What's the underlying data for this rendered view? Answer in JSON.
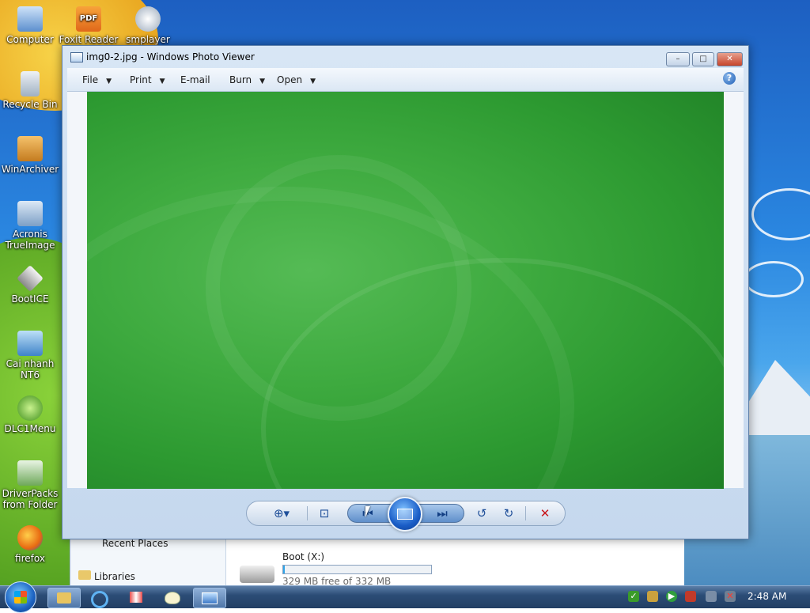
{
  "desktop": {
    "icons": [
      {
        "label": "Computer"
      },
      {
        "label": "Foxit Reader"
      },
      {
        "label": "smplayer"
      },
      {
        "label": "Recycle Bin"
      },
      {
        "label": "WinArchiver"
      },
      {
        "label": "Acronis TrueImage"
      },
      {
        "label": "BootICE"
      },
      {
        "label": "Cai nhanh NT6"
      },
      {
        "label": "DLC1Menu"
      },
      {
        "label": "DriverPacks from Folder"
      },
      {
        "label": "firefox"
      }
    ],
    "foxit_badge": "PDF"
  },
  "window": {
    "title": "img0-2.jpg - Windows Photo Viewer",
    "controls": {
      "minimize": "–",
      "maximize": "□",
      "close": "✕"
    },
    "menu": [
      {
        "label": "File",
        "has_dropdown": true
      },
      {
        "label": "Print",
        "has_dropdown": true
      },
      {
        "label": "E-mail",
        "has_dropdown": false
      },
      {
        "label": "Burn",
        "has_dropdown": true
      },
      {
        "label": "Open",
        "has_dropdown": true
      }
    ],
    "help": "?",
    "toolbar": {
      "buttons": [
        "zoom-icon",
        "actual-size-icon",
        "previous-icon",
        "slideshow-icon",
        "next-icon",
        "rotate-counterclockwise-icon",
        "rotate-clockwise-icon",
        "delete-icon"
      ],
      "glyphs": {
        "zoom": "⊕▾",
        "actual_size": "⊡",
        "previous": "⏮",
        "next": "⏭",
        "rotate_ccw": "↺",
        "rotate_cw": "↻",
        "delete": "✕"
      }
    }
  },
  "background_window": {
    "nav_items": [
      "Recent Places",
      "Libraries"
    ],
    "drive": {
      "name": "Boot (X:)",
      "free": "329 MB free of 332 MB",
      "fill_fraction": 0.01
    }
  },
  "taskbar": {
    "clock": "2:48 AM",
    "pinned": [
      "explorer-icon",
      "ie-icon",
      "hjsplit-icon",
      "paint-icon",
      "photo-viewer-icon"
    ],
    "tray": [
      "antivirus-icon",
      "network-drive-icon",
      "media-icon",
      "flag-icon",
      "display-icon",
      "volume-muted-icon"
    ]
  },
  "colors": {
    "accent": "#1d63c2",
    "photo_green": "#3fab40"
  }
}
